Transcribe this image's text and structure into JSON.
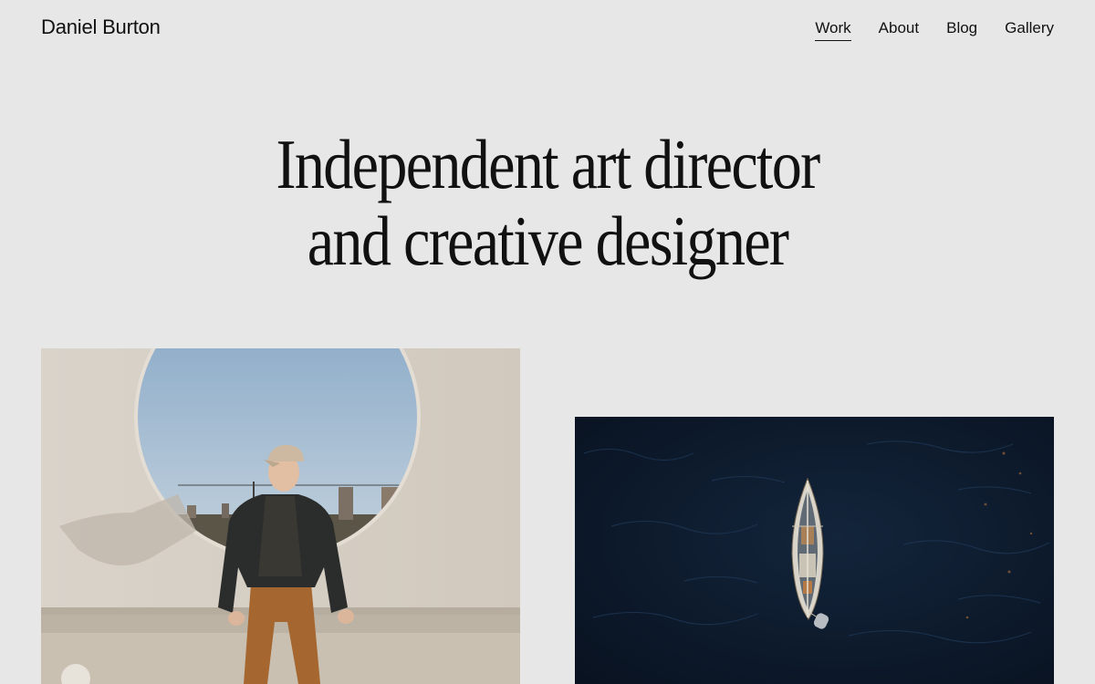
{
  "header": {
    "brand": "Daniel Burton",
    "nav": [
      {
        "label": "Work",
        "active": true
      },
      {
        "label": "About",
        "active": false
      },
      {
        "label": "Blog",
        "active": false
      },
      {
        "label": "Gallery",
        "active": false
      }
    ]
  },
  "hero": {
    "title_line_1": "Independent art director",
    "title_line_2": "and creative designer"
  },
  "gallery": {
    "items": [
      {
        "subject": "portrait-young-man-sitting-below-circular-window"
      },
      {
        "subject": "aerial-sailboat-on-dark-sea"
      }
    ]
  },
  "colors": {
    "background": "#e7e7e7",
    "text": "#111111",
    "sea": "#0c1a2c",
    "wall": "#d8d1c7",
    "sky": "#a9c1d6"
  }
}
